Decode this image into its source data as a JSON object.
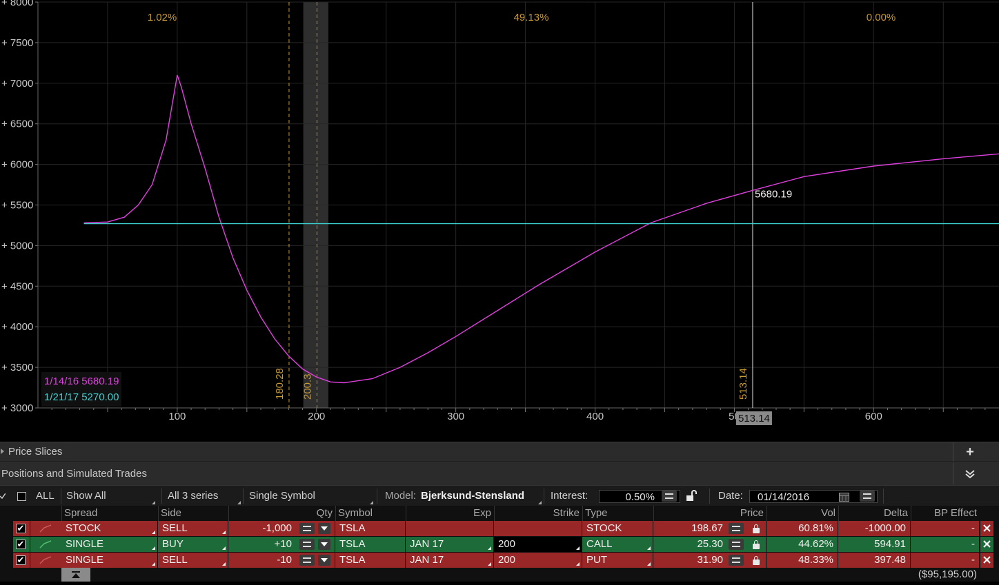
{
  "chart_data": {
    "type": "line",
    "x_ticks": [
      "100",
      "200",
      "300",
      "400",
      "50",
      "600"
    ],
    "y_ticks": [
      "+ 8000",
      "+ 7500",
      "+ 7000",
      "+ 6500",
      "+ 6000",
      "+ 5500",
      "+ 5000",
      "+ 4500",
      "+ 4000",
      "+ 3500",
      "+ 3000"
    ],
    "xlim": [
      0,
      690
    ],
    "ylim": [
      3000,
      8000
    ],
    "region_pcts": [
      "1.02%",
      "49.13%",
      "0.00%"
    ],
    "vertical_markers": [
      {
        "label": "180.28",
        "x": 180.28
      },
      {
        "label": "200.3",
        "x": 200.3
      },
      {
        "label": "513.14",
        "x": 513.14
      }
    ],
    "cursor_x_label": "513.14",
    "cursor_value_label": "5680.19",
    "series": [
      {
        "name": "1/14/16 5680.19",
        "color": "#e040e0",
        "x": [
          33,
          50,
          62,
          72,
          82,
          92,
          100,
          103,
          110,
          120,
          130,
          140,
          150,
          160,
          170,
          180,
          190,
          200,
          210,
          220,
          240,
          260,
          280,
          300,
          330,
          360,
          400,
          440,
          480,
          513.14,
          550,
          600,
          650,
          690
        ],
        "y": [
          5280,
          5290,
          5350,
          5500,
          5750,
          6300,
          7100,
          6950,
          6500,
          5950,
          5350,
          4850,
          4450,
          4120,
          3850,
          3640,
          3480,
          3380,
          3320,
          3310,
          3360,
          3500,
          3680,
          3880,
          4200,
          4520,
          4920,
          5280,
          5520,
          5680.19,
          5850,
          5980,
          6070,
          6130
        ]
      },
      {
        "name": "1/21/17 5270.00",
        "color": "#3fd0d0",
        "x": [
          33,
          690
        ],
        "y": [
          5270,
          5270
        ]
      }
    ]
  },
  "panels": {
    "price_slices": "Price Slices",
    "positions": "Positions and Simulated Trades",
    "plus_icon": "+",
    "collapse_icon": "chevron-double-down-icon"
  },
  "toolbar": {
    "all_label": "ALL",
    "show_all": "Show All",
    "series": "All 3 series",
    "symbol_mode": "Single Symbol",
    "model_label": "Model:",
    "model_value": "Bjerksund-Stensland",
    "interest_label": "Interest:",
    "interest_value": "0.50%",
    "date_label": "Date:",
    "date_value": "01/14/2016"
  },
  "table": {
    "headers": {
      "spread": "Spread",
      "side": "Side",
      "qty": "Qty",
      "symbol": "Symbol",
      "exp": "Exp",
      "strike": "Strike",
      "type": "Type",
      "price": "Price",
      "vol": "Vol",
      "delta": "Delta",
      "bp": "BP Effect"
    },
    "rows": [
      {
        "spread": "STOCK",
        "side": "SELL",
        "qty": "-1,000",
        "symbol": "TSLA",
        "exp": "",
        "strike": "",
        "type": "STOCK",
        "price": "198.67",
        "vol": "60.81%",
        "delta": "-1000.00",
        "bp": "-",
        "color": "red"
      },
      {
        "spread": "SINGLE",
        "side": "BUY",
        "qty": "+10",
        "symbol": "TSLA",
        "exp": "JAN 17",
        "strike": "200",
        "type": "CALL",
        "price": "25.30",
        "vol": "44.62%",
        "delta": "594.91",
        "bp": "-",
        "color": "green"
      },
      {
        "spread": "SINGLE",
        "side": "SELL",
        "qty": "-10",
        "symbol": "TSLA",
        "exp": "JAN 17",
        "strike": "200",
        "type": "PUT",
        "price": "31.90",
        "vol": "48.33%",
        "delta": "397.48",
        "bp": "-",
        "color": "red"
      }
    ],
    "total_bp": "($95,195.00)"
  }
}
